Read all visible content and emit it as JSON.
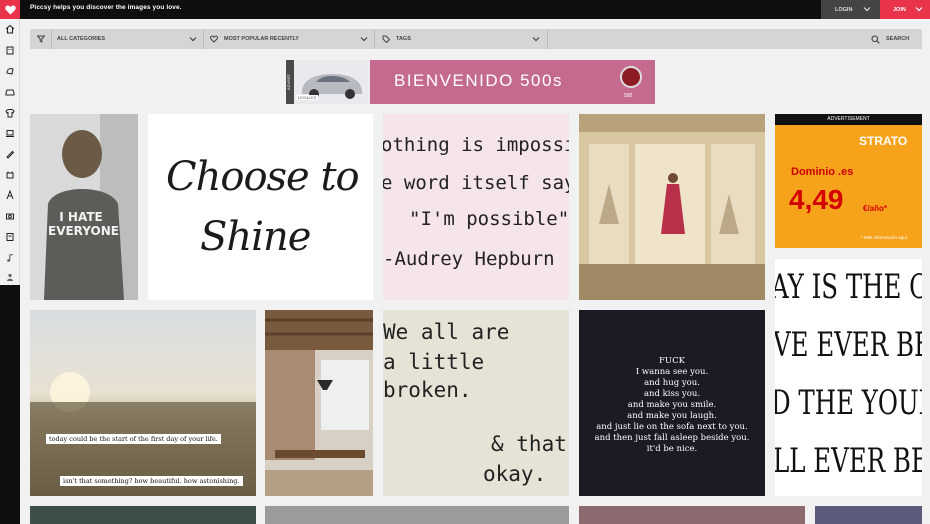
{
  "header": {
    "tagline": "Piccsy helps you discover the images you love.",
    "login_label": "LOGIN",
    "join_label": "JOIN",
    "accent_color": "#e8334a"
  },
  "sidebar": {
    "items": [
      {
        "icon": "home-icon"
      },
      {
        "icon": "building-icon"
      },
      {
        "icon": "animal-icon"
      },
      {
        "icon": "car-icon"
      },
      {
        "icon": "shirt-icon"
      },
      {
        "icon": "laptop-icon"
      },
      {
        "icon": "pencil-icon"
      },
      {
        "icon": "food-icon"
      },
      {
        "icon": "typography-icon"
      },
      {
        "icon": "camera-icon"
      },
      {
        "icon": "book-icon"
      },
      {
        "icon": "music-icon"
      },
      {
        "icon": "people-icon"
      }
    ]
  },
  "filters": {
    "category_label": "ALL CATEGORIES",
    "sort_label": "MOST POPULAR RECENTLY",
    "tags_label": "TAGS",
    "search_label": "SEARCH"
  },
  "ads": {
    "banner": {
      "slogan": "BIENVENIDO 500s",
      "advert_label": "ADVERT",
      "legales_label": "LEGALES",
      "brand_model": "500"
    },
    "side": {
      "header_label": "ADVERTISEMENT",
      "brand": "STRATO",
      "dominio_label": "Dominio .es",
      "price": "4,49",
      "unit": "€/año*",
      "more_info": "* Más información aquí"
    }
  },
  "images": [
    {
      "caption": "I HATE EVERYONE"
    },
    {
      "caption_line1": "Choose to",
      "caption_line2": "Shine"
    },
    {
      "line1": "othing is impossible",
      "line2": "e word itself says",
      "line3": "\"I'm possible\"",
      "line4": "-Audrey Hepburn"
    },
    {
      "caption": ""
    },
    {
      "line1": "AY IS THE OLDE",
      "line2": "VE EVER BEEN",
      "line3": "D THE YOUNGES",
      "line4": "LL EVER BE AG"
    },
    {
      "line1": "today could be the start of  the first day of your life.",
      "line2": "isn't that something? how beautiful. how astonishing."
    },
    {
      "caption": ""
    },
    {
      "line1": "We all are",
      "line2": "a little",
      "line3": "broken.",
      "line4": "& that",
      "line5": "okay."
    },
    {
      "line1": "FUCK",
      "line2": "I wanna see you.",
      "line3": "and hug you.",
      "line4": "and kiss you.",
      "line5": "and make you smile.",
      "line6": "and make you laugh.",
      "line7": "and just lie on the sofa next to you.",
      "line8": "and then just fall asleep beside you.",
      "line9": "it'd be nice."
    }
  ]
}
